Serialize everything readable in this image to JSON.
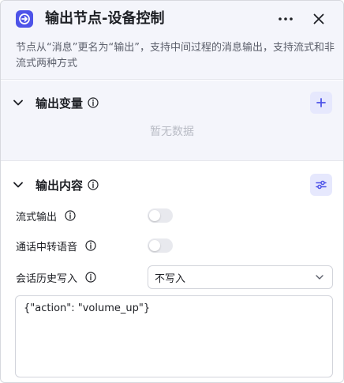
{
  "header": {
    "title": "输出节点-设备控制",
    "description": "节点从“消息”更名为“输出”，支持中间过程的消息输出，支持流式和非流式两种方式"
  },
  "output_variables": {
    "title": "输出变量",
    "empty_text": "暂无数据"
  },
  "output_content": {
    "title": "输出内容",
    "streaming_label": "流式输出",
    "streaming_on": false,
    "tts_label": "通话中转语音",
    "tts_on": false,
    "history_label": "会话历史写入",
    "history_value": "不写入",
    "content": "{\"action\": \"volume_up\"}"
  },
  "colors": {
    "accent": "#4d53e8",
    "header_bg": "#f4f5fb",
    "toggle_off": "#e8e9ee"
  }
}
